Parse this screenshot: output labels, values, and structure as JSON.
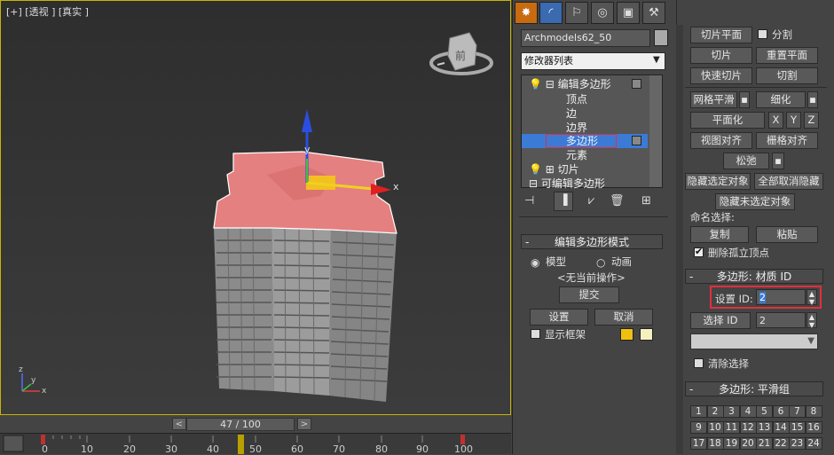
{
  "viewport": {
    "label": "[+] [透视 ] [真实 ]",
    "gizmo_x": "x",
    "gizmo_y": "y",
    "axis_x": "x",
    "axis_y": "y",
    "axis_z": "z",
    "viewcube_label": "前"
  },
  "timeline": {
    "frame": "47 / 100",
    "prev": "<",
    "next": ">",
    "ticks": [
      "0",
      "10",
      "20",
      "30",
      "40",
      "50",
      "60",
      "70",
      "80",
      "90",
      "100"
    ]
  },
  "command_panel": {
    "object_name": "Archmodels62_50",
    "modifier_list": "修改器列表",
    "stack": [
      {
        "label": "编辑多边形",
        "level": 0
      },
      {
        "label": "顶点",
        "level": 1
      },
      {
        "label": "边",
        "level": 1
      },
      {
        "label": "边界",
        "level": 1
      },
      {
        "label": "多边形",
        "level": 1
      },
      {
        "label": "元素",
        "level": 1
      },
      {
        "label": "切片",
        "level": 0
      },
      {
        "label": "可编辑多边形",
        "level": 0
      }
    ],
    "mode_rollout": {
      "title": "编辑多边形模式",
      "model": "模型",
      "animate": "动画",
      "status": "<无当前操作>",
      "commit": "提交",
      "settings": "设置",
      "cancel": "取消",
      "show_cage": "显示框架"
    }
  },
  "rollouts": {
    "slice_plane": "切片平面",
    "split": "分割",
    "slice": "切片",
    "reset_plane": "重置平面",
    "quick_slice": "快速切片",
    "cut": "切割",
    "meshsmooth": "网格平滑",
    "tessellate": "细化",
    "make_planar": "平面化",
    "x": "X",
    "y": "Y",
    "z": "Z",
    "view_align": "视图对齐",
    "grid_align": "栅格对齐",
    "relax": "松弛",
    "hide_selected": "隐藏选定对象",
    "unhide_all": "全部取消隐藏",
    "hide_unselected": "隐藏未选定对象",
    "named_sel": "命名选择:",
    "copy": "复制",
    "paste": "粘贴",
    "delete_isolated": "删除孤立顶点",
    "material_title": "多边形: 材质 ID",
    "set_id": "设置 ID:",
    "set_id_value": "2",
    "select_id": "选择 ID",
    "select_id_value": "2",
    "clear_selection": "清除选择",
    "smooth_title": "多边形: 平滑组",
    "smooth_groups": [
      "1",
      "2",
      "3",
      "4",
      "5",
      "6",
      "7",
      "8",
      "9",
      "10",
      "11",
      "12",
      "13",
      "14",
      "15",
      "16",
      "17",
      "18",
      "19",
      "20",
      "21",
      "22",
      "23",
      "24"
    ]
  },
  "colors": {
    "highlight_red": "#e0303c",
    "selection_blue": "#3b7bd6",
    "swatch_yellow": "#f0c010",
    "swatch_pale": "#f5f0c0"
  }
}
